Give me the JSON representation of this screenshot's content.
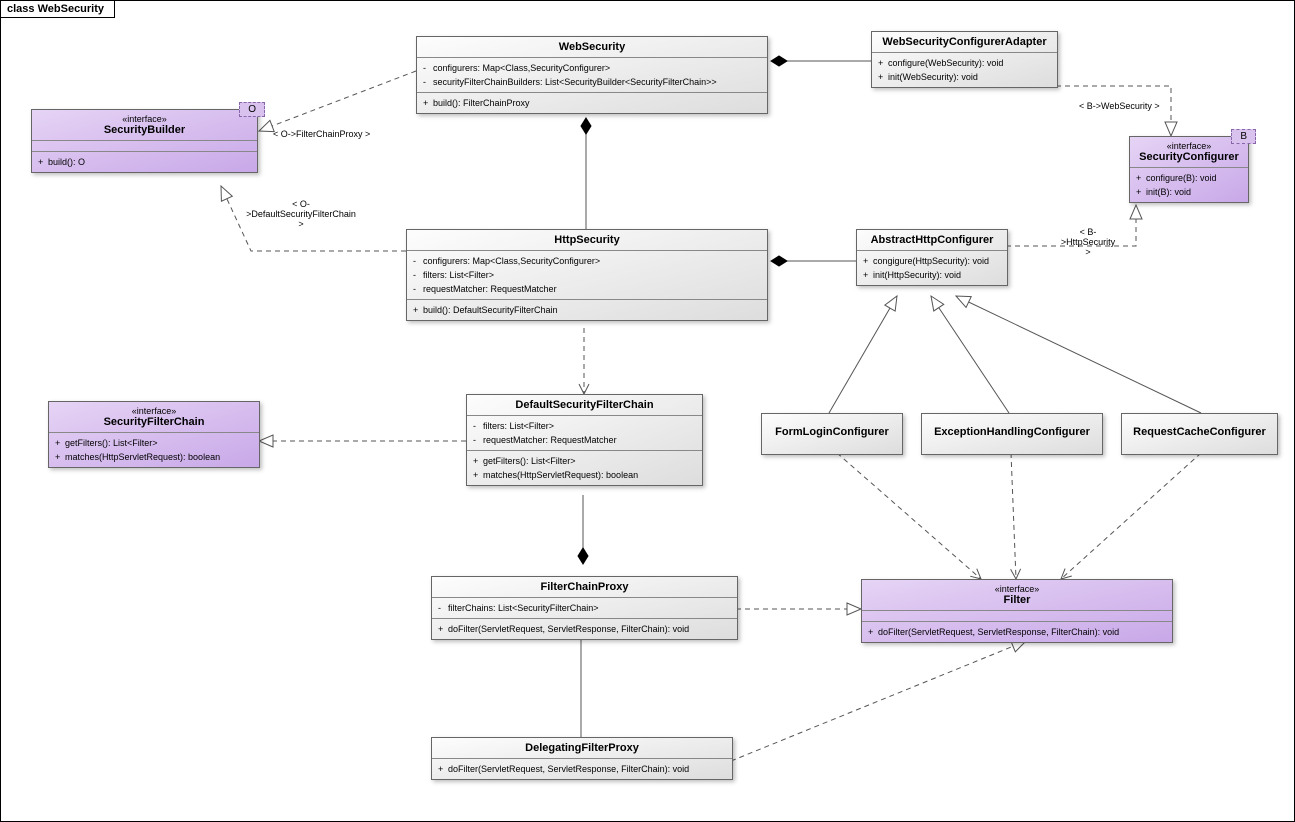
{
  "frame": {
    "prefix": "class",
    "name": "WebSecurity"
  },
  "boxes": {
    "securityBuilder": {
      "stereotype": "«interface»",
      "name": "SecurityBuilder",
      "tparam": "O",
      "ops": [
        {
          "vis": "+",
          "sig": "build(): O"
        }
      ]
    },
    "webSecurity": {
      "name": "WebSecurity",
      "attrs": [
        {
          "vis": "-",
          "sig": "configurers: Map<Class,SecurityConfigurer>"
        },
        {
          "vis": "-",
          "sig": "securityFilterChainBuilders: List<SecurityBuilder<SecurityFilterChain>>"
        }
      ],
      "ops": [
        {
          "vis": "+",
          "sig": "build(): FilterChainProxy"
        }
      ]
    },
    "webSecurityConfigurerAdapter": {
      "name": "WebSecurityConfigurerAdapter",
      "ops": [
        {
          "vis": "+",
          "sig": "configure(WebSecurity): void"
        },
        {
          "vis": "+",
          "sig": "init(WebSecurity): void"
        }
      ]
    },
    "securityConfigurer": {
      "stereotype": "«interface»",
      "name": "SecurityConfigurer",
      "tparam": "B",
      "ops": [
        {
          "vis": "+",
          "sig": "configure(B): void"
        },
        {
          "vis": "+",
          "sig": "init(B): void"
        }
      ]
    },
    "httpSecurity": {
      "name": "HttpSecurity",
      "attrs": [
        {
          "vis": "-",
          "sig": "configurers: Map<Class,SecurityConfigurer>"
        },
        {
          "vis": "-",
          "sig": "filters: List<Filter>"
        },
        {
          "vis": "-",
          "sig": "requestMatcher: RequestMatcher"
        }
      ],
      "ops": [
        {
          "vis": "+",
          "sig": "build(): DefaultSecurityFilterChain"
        }
      ]
    },
    "abstractHttpConfigurer": {
      "name": "AbstractHttpConfigurer",
      "ops": [
        {
          "vis": "+",
          "sig": "congigure(HttpSecurity): void"
        },
        {
          "vis": "+",
          "sig": "init(HttpSecurity): void"
        }
      ]
    },
    "securityFilterChain": {
      "stereotype": "«interface»",
      "name": "SecurityFilterChain",
      "ops": [
        {
          "vis": "+",
          "sig": "getFilters(): List<Filter>"
        },
        {
          "vis": "+",
          "sig": "matches(HttpServletRequest): boolean"
        }
      ]
    },
    "defaultSecurityFilterChain": {
      "name": "DefaultSecurityFilterChain",
      "attrs": [
        {
          "vis": "-",
          "sig": "filters: List<Filter>"
        },
        {
          "vis": "-",
          "sig": "requestMatcher: RequestMatcher"
        }
      ],
      "ops": [
        {
          "vis": "+",
          "sig": "getFilters(): List<Filter>"
        },
        {
          "vis": "+",
          "sig": "matches(HttpServletRequest): boolean"
        }
      ]
    },
    "formLoginConfigurer": {
      "name": "FormLoginConfigurer"
    },
    "exceptionHandlingConfigurer": {
      "name": "ExceptionHandlingConfigurer"
    },
    "requestCacheConfigurer": {
      "name": "RequestCacheConfigurer"
    },
    "filterChainProxy": {
      "name": "FilterChainProxy",
      "attrs": [
        {
          "vis": "-",
          "sig": "filterChains: List<SecurityFilterChain>"
        }
      ],
      "ops": [
        {
          "vis": "+",
          "sig": "doFilter(ServletRequest, ServletResponse, FilterChain): void"
        }
      ]
    },
    "filter": {
      "stereotype": "«interface»",
      "name": "Filter",
      "ops": [
        {
          "vis": "+",
          "sig": "doFilter(ServletRequest, ServletResponse, FilterChain): void"
        }
      ]
    },
    "delegatingFilterProxy": {
      "name": "DelegatingFilterProxy",
      "ops": [
        {
          "vis": "+",
          "sig": "doFilter(ServletRequest, ServletResponse, FilterChain): void"
        }
      ]
    }
  },
  "labels": {
    "l1": "< O->FilterChainProxy >",
    "l2a": "< O-",
    "l2b": ">DefaultSecurityFilterChain",
    "l2c": ">",
    "l3": "< B->WebSecurity >",
    "l4a": "< B-",
    "l4b": ">HttpSecurity",
    "l4c": ">"
  }
}
